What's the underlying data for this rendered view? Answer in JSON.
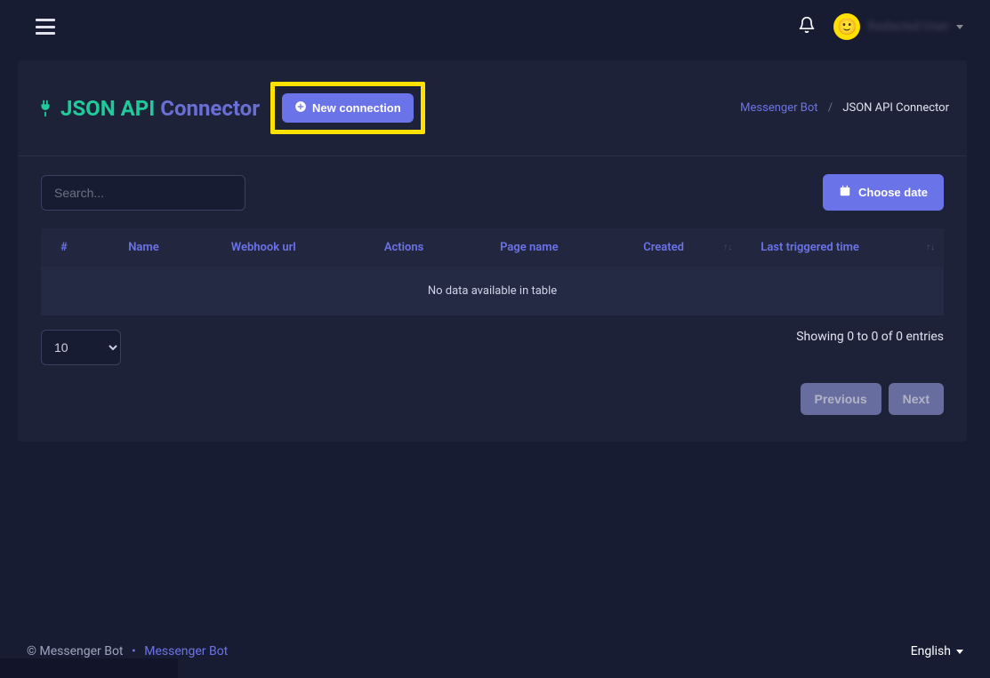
{
  "topbar": {
    "user_name": "Redacted User"
  },
  "header": {
    "title_part1": "JSON API",
    "title_part2": "Connector",
    "new_connection_label": "New connection"
  },
  "breadcrumbs": {
    "parent": "Messenger Bot",
    "current": "JSON API Connector"
  },
  "toolbar": {
    "search_placeholder": "Search...",
    "choose_date_label": "Choose date"
  },
  "table": {
    "columns": {
      "index": "#",
      "name": "Name",
      "webhook": "Webhook url",
      "actions": "Actions",
      "page_name": "Page name",
      "created": "Created",
      "last_triggered": "Last triggered time"
    },
    "empty_message": "No data available in table"
  },
  "page_size": {
    "value": "10"
  },
  "entries_info": "Showing 0 to 0 of 0 entries",
  "pagination": {
    "previous": "Previous",
    "next": "Next"
  },
  "footer": {
    "copyright": "© Messenger Bot",
    "link": "Messenger Bot",
    "language": "English"
  }
}
